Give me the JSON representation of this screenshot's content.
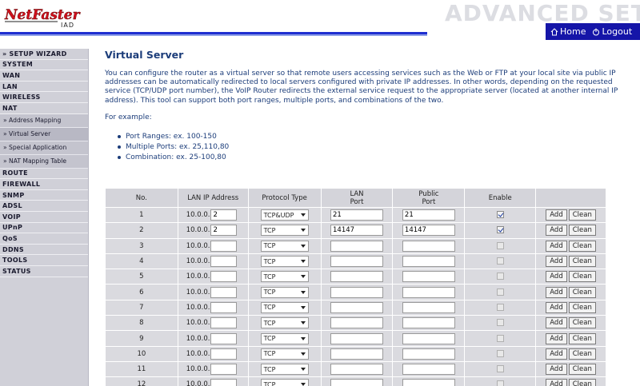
{
  "header": {
    "logo_text": "NetFaster IAD",
    "title": "ADVANCED SETUP",
    "home_label": "Home",
    "logout_label": "Logout"
  },
  "sidebar": {
    "items": [
      {
        "label": "» SETUP WIZARD",
        "type": "main"
      },
      {
        "label": "SYSTEM",
        "type": "main"
      },
      {
        "label": "WAN",
        "type": "main"
      },
      {
        "label": "LAN",
        "type": "main"
      },
      {
        "label": "WIRELESS",
        "type": "main"
      },
      {
        "label": "NAT",
        "type": "main"
      },
      {
        "label": "» Address Mapping",
        "type": "sub"
      },
      {
        "label": "» Virtual Server",
        "type": "sub",
        "active": true
      },
      {
        "label": "» Special Application",
        "type": "sub"
      },
      {
        "label": "» NAT Mapping Table",
        "type": "sub"
      },
      {
        "label": "ROUTE",
        "type": "main"
      },
      {
        "label": "FIREWALL",
        "type": "main"
      },
      {
        "label": "SNMP",
        "type": "main"
      },
      {
        "label": "ADSL",
        "type": "main"
      },
      {
        "label": "VOIP",
        "type": "main"
      },
      {
        "label": "UPnP",
        "type": "main"
      },
      {
        "label": "QoS",
        "type": "main"
      },
      {
        "label": "DDNS",
        "type": "main"
      },
      {
        "label": "TOOLS",
        "type": "main"
      },
      {
        "label": "STATUS",
        "type": "main"
      }
    ]
  },
  "main": {
    "title": "Virtual Server",
    "intro": "You can configure the router as a virtual server so that remote users accessing services such as the Web or FTP at your local site via public IP addresses can be automatically redirected to local servers configured with private IP addresses. In other words, depending on the requested service (TCP/UDP port number), the VoIP Router redirects the external service request to the appropriate server (located at another internal IP address). This tool can support both port ranges, multiple ports, and combinations of the two.",
    "example_head": "For example:",
    "examples": [
      "Port Ranges: ex. 100-150",
      "Multiple Ports: ex. 25,110,80",
      "Combination: ex. 25-100,80"
    ]
  },
  "table": {
    "headers": {
      "no": "No.",
      "ip": "LAN IP Address",
      "proto": "Protocol Type",
      "lan_line1": "LAN",
      "lan_line2": "Port",
      "pub_line1": "Public",
      "pub_line2": "Port",
      "enable": "Enable"
    },
    "ip_prefix": "10.0.0.",
    "add_label": "Add",
    "clean_label": "Clean",
    "rows": [
      {
        "no": "1",
        "ip_last": "2",
        "proto": "TCP&UDP",
        "lan_port": "21",
        "public_port": "21",
        "enabled": true
      },
      {
        "no": "2",
        "ip_last": "2",
        "proto": "TCP",
        "lan_port": "14147",
        "public_port": "14147",
        "enabled": true
      },
      {
        "no": "3",
        "ip_last": "",
        "proto": "TCP",
        "lan_port": "",
        "public_port": "",
        "enabled": false
      },
      {
        "no": "4",
        "ip_last": "",
        "proto": "TCP",
        "lan_port": "",
        "public_port": "",
        "enabled": false
      },
      {
        "no": "5",
        "ip_last": "",
        "proto": "TCP",
        "lan_port": "",
        "public_port": "",
        "enabled": false
      },
      {
        "no": "6",
        "ip_last": "",
        "proto": "TCP",
        "lan_port": "",
        "public_port": "",
        "enabled": false
      },
      {
        "no": "7",
        "ip_last": "",
        "proto": "TCP",
        "lan_port": "",
        "public_port": "",
        "enabled": false
      },
      {
        "no": "8",
        "ip_last": "",
        "proto": "TCP",
        "lan_port": "",
        "public_port": "",
        "enabled": false
      },
      {
        "no": "9",
        "ip_last": "",
        "proto": "TCP",
        "lan_port": "",
        "public_port": "",
        "enabled": false
      },
      {
        "no": "10",
        "ip_last": "",
        "proto": "TCP",
        "lan_port": "",
        "public_port": "",
        "enabled": false
      },
      {
        "no": "11",
        "ip_last": "",
        "proto": "TCP",
        "lan_port": "",
        "public_port": "",
        "enabled": false
      },
      {
        "no": "12",
        "ip_last": "",
        "proto": "TCP",
        "lan_port": "",
        "public_port": "",
        "enabled": false
      }
    ]
  },
  "colors": {
    "brand_red": "#d0101c",
    "nav_blue": "#1515a8",
    "title_blue": "#1c3d7a"
  }
}
